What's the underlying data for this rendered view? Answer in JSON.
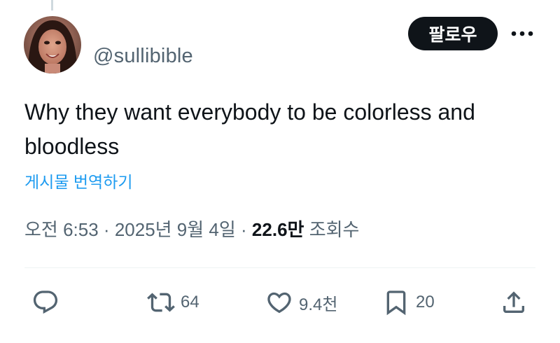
{
  "author": {
    "handle": "@sullibible"
  },
  "header": {
    "follow_label": "팔로우"
  },
  "tweet": {
    "text": "Why they want everybody to be colorless and bloodless",
    "translate_label": "게시물 번역하기"
  },
  "meta": {
    "time": "오전 6:53",
    "separator": "·",
    "date": "2025년 9월 4일",
    "views_count": "22.6만",
    "views_label": "조회수"
  },
  "actions": {
    "reply": {
      "icon": "reply-icon",
      "count": ""
    },
    "retweet": {
      "icon": "retweet-icon",
      "count": "64"
    },
    "like": {
      "icon": "heart-icon",
      "count": "9.4천"
    },
    "bookmark": {
      "icon": "bookmark-icon",
      "count": "20"
    },
    "share": {
      "icon": "share-icon",
      "count": ""
    }
  },
  "colors": {
    "text_primary": "#0f1419",
    "text_secondary": "#536471",
    "link": "#1d9bf0",
    "follow_bg": "#0f1419",
    "follow_text": "#ffffff"
  }
}
